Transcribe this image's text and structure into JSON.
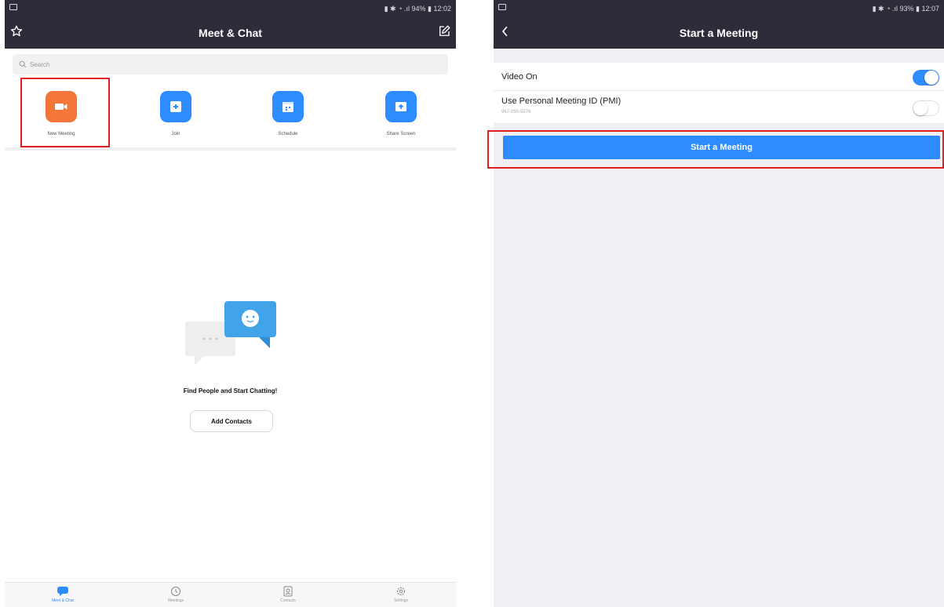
{
  "left": {
    "statusbar": {
      "right_text": "▮ ✱ ◔ .ıl 94% ▮ 12:02"
    },
    "header": {
      "title": "Meet & Chat"
    },
    "search": {
      "placeholder": "Search"
    },
    "actions": [
      {
        "label": "New Meeting",
        "color": "#f3773b",
        "icon": "video-camera-icon"
      },
      {
        "label": "Join",
        "color": "#2d8cff",
        "icon": "plus-box-icon"
      },
      {
        "label": "Schedule",
        "color": "#2d8cff",
        "icon": "calendar-icon"
      },
      {
        "label": "Share Screen",
        "color": "#2d8cff",
        "icon": "share-screen-icon"
      }
    ],
    "empty_state": {
      "title": "Find People and Start Chatting!",
      "button": "Add Contacts"
    },
    "tabs": [
      {
        "label": "Meet & Chat",
        "icon": "chat-bubble-icon",
        "active": true
      },
      {
        "label": "Meetings",
        "icon": "clock-icon",
        "active": false
      },
      {
        "label": "Contacts",
        "icon": "contact-card-icon",
        "active": false
      },
      {
        "label": "Settings",
        "icon": "gear-icon",
        "active": false
      }
    ]
  },
  "right": {
    "statusbar": {
      "right_text": "▮ ✱ ◔ .ıl 93% ▮ 12:07"
    },
    "header": {
      "title": "Start a Meeting"
    },
    "settings": [
      {
        "label": "Video On",
        "value": "on"
      },
      {
        "label": "Use Personal Meeting ID (PMI)",
        "sublabel": "967-050-5576",
        "value": "off"
      }
    ],
    "start_button": "Start a Meeting"
  },
  "colors": {
    "header_bg": "#2d2d3a",
    "accent_blue": "#2d8cff",
    "accent_orange": "#f3773b",
    "highlight_red": "#e02020",
    "right_bg": "#efeff4"
  }
}
